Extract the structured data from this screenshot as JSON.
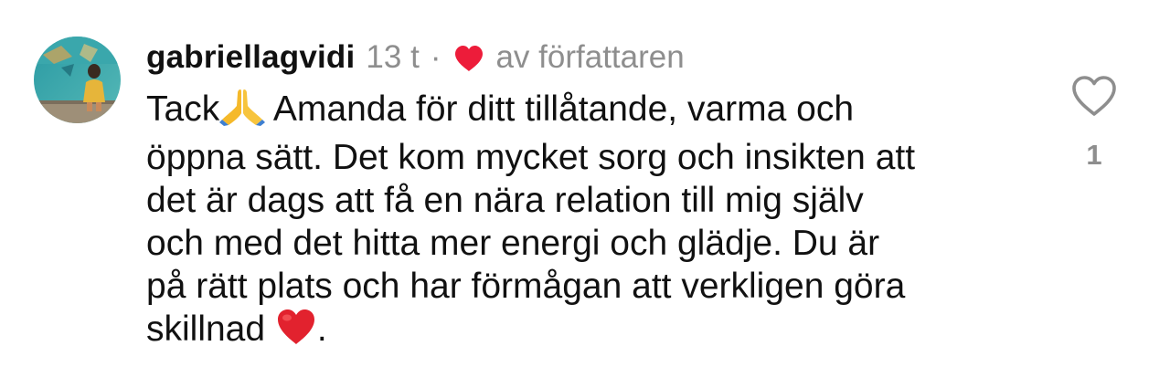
{
  "comment": {
    "username": "gabriellagvidi",
    "time": "13 t",
    "separator": "·",
    "liked_by_author": "av författaren",
    "lines": [
      {
        "before": "Tack",
        "emoji": "folded-hands-emoji",
        "after": " Amanda för ditt tillåtande, varma och"
      },
      {
        "text": "öppna sätt. Det kom mycket sorg och insikten att"
      },
      {
        "text": "det är dags att få en nära relation till mig själv"
      },
      {
        "text": "och med det hitta mer energi och glädje. Du är"
      },
      {
        "text": "på rätt plats och har förmågan att verkligen göra"
      },
      {
        "before": "skillnad ",
        "emoji": "red-heart-emoji",
        "after": "."
      }
    ],
    "like_count": "1"
  },
  "icons": {
    "author_heart": "red-heart-icon",
    "like": "heart-outline-icon"
  },
  "colors": {
    "text": "#111111",
    "secondary": "#8e8e8e",
    "heart_red": "#ed1c3a"
  }
}
